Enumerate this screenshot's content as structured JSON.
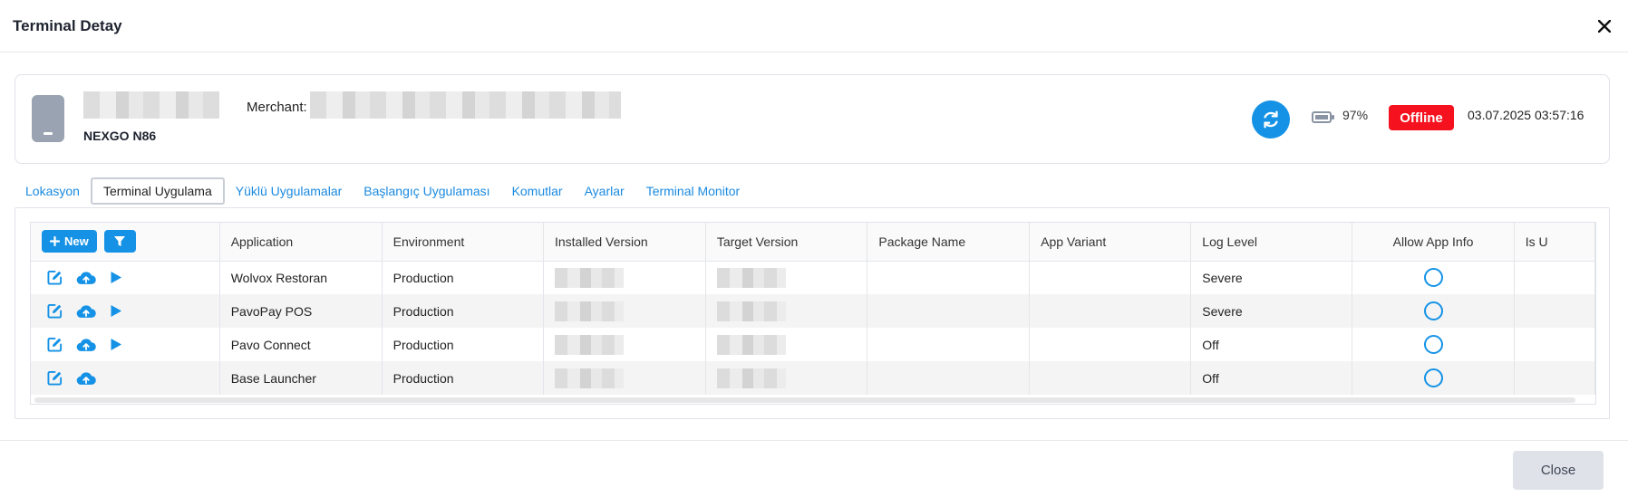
{
  "modal": {
    "title": "Terminal Detay"
  },
  "device": {
    "model": "NEXGO N86",
    "merchant_label": "Merchant:",
    "battery_pct": "97%",
    "battery_level": 0.97,
    "status": "Offline",
    "timestamp": "03.07.2025 03:57:16"
  },
  "tabs": [
    {
      "label": "Lokasyon"
    },
    {
      "label": "Terminal Uygulama"
    },
    {
      "label": "Yüklü Uygulamalar"
    },
    {
      "label": "Başlangıç Uygulaması"
    },
    {
      "label": "Komutlar"
    },
    {
      "label": "Ayarlar"
    },
    {
      "label": "Terminal Monitor"
    }
  ],
  "active_tab": "Terminal Uygulama",
  "grid": {
    "new_label": "New",
    "columns": [
      "Application",
      "Environment",
      "Installed Version",
      "Target Version",
      "Package Name",
      "App Variant",
      "Log Level",
      "Allow App Info",
      "Is U"
    ],
    "rows": [
      {
        "application": "Wolvox Restoran",
        "environment": "Production",
        "log_level": "Severe",
        "has_play": true
      },
      {
        "application": "PavoPay POS",
        "environment": "Production",
        "log_level": "Severe",
        "has_play": true
      },
      {
        "application": "Pavo Connect",
        "environment": "Production",
        "log_level": "Off",
        "has_play": true
      },
      {
        "application": "Base Launcher",
        "environment": "Production",
        "log_level": "Off",
        "has_play": false
      }
    ]
  },
  "footer": {
    "close_label": "Close"
  },
  "colors": {
    "accent": "#1592e6",
    "offline": "#f5111d"
  }
}
